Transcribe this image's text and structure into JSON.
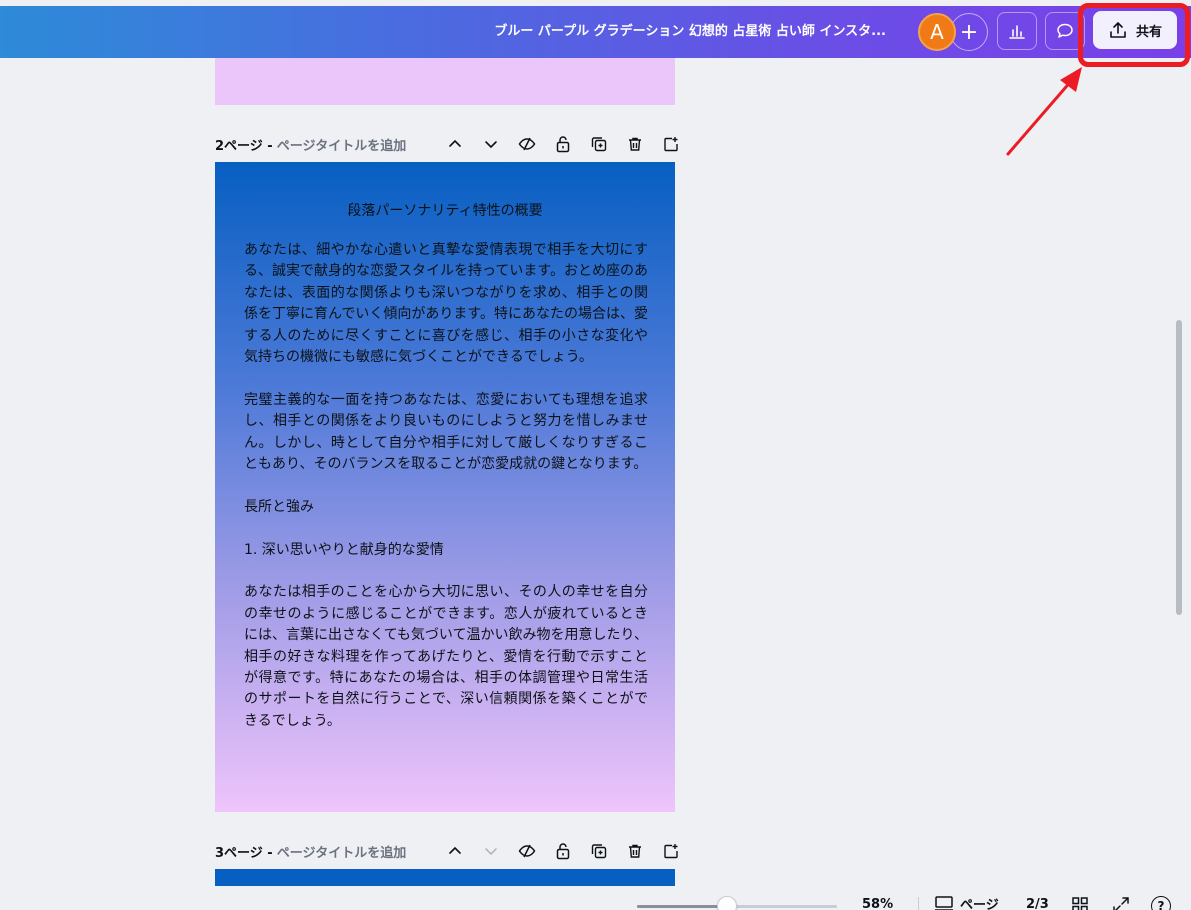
{
  "header": {
    "doc_title": "ブルー パープル グラデーション 幻想的 占星術 占い師 インスタ...",
    "avatar_initial": "A",
    "add_label": "+",
    "share_label": "共有"
  },
  "pages": [
    {
      "number_label": "2ページ -",
      "title_placeholder": "ページタイトルを追加",
      "heading": "段落パーソナリティ特性の概要",
      "paragraphs": [
        "あなたは、細やかな心遣いと真摯な愛情表現で相手を大切にする、誠実で献身的な恋愛スタイルを持っています。おとめ座のあなたは、表面的な関係よりも深いつながりを求め、相手との関係を丁寧に育んでいく傾向があります。特にあなたの場合は、愛する人のために尽くすことに喜びを感じ、相手の小さな変化や気持ちの機微にも敏感に気づくことができるでしょう。",
        "完璧主義的な一面を持つあなたは、恋愛においても理想を追求し、相手との関係をより良いものにしようと努力を惜しみません。しかし、時として自分や相手に対して厳しくなりすぎることもあり、そのバランスを取ることが恋愛成就の鍵となります。",
        "長所と強み",
        "1. 深い思いやりと献身的な愛情",
        "あなたは相手のことを心から大切に思い、その人の幸せを自分の幸せのように感じることができます。恋人が疲れているときには、言葉に出さなくても気づいて温かい飲み物を用意したり、相手の好きな料理を作ってあげたりと、愛情を行動で示すことが得意です。特にあなたの場合は、相手の体調管理や日常生活のサポートを自然に行うことで、深い信頼関係を築くことができるでしょう。"
      ]
    },
    {
      "number_label": "3ページ -",
      "title_placeholder": "ページタイトルを追加"
    }
  ],
  "footer": {
    "zoom_value": "58%",
    "zoom_fraction": 0.45,
    "pages_label": "ページ",
    "page_count": "2/3",
    "help_label": "?"
  },
  "colors": {
    "accent_highlight": "#ec1c24",
    "topbar_start": "#2d8bd8",
    "topbar_end": "#7b3fe8",
    "avatar": "#f07a16"
  }
}
